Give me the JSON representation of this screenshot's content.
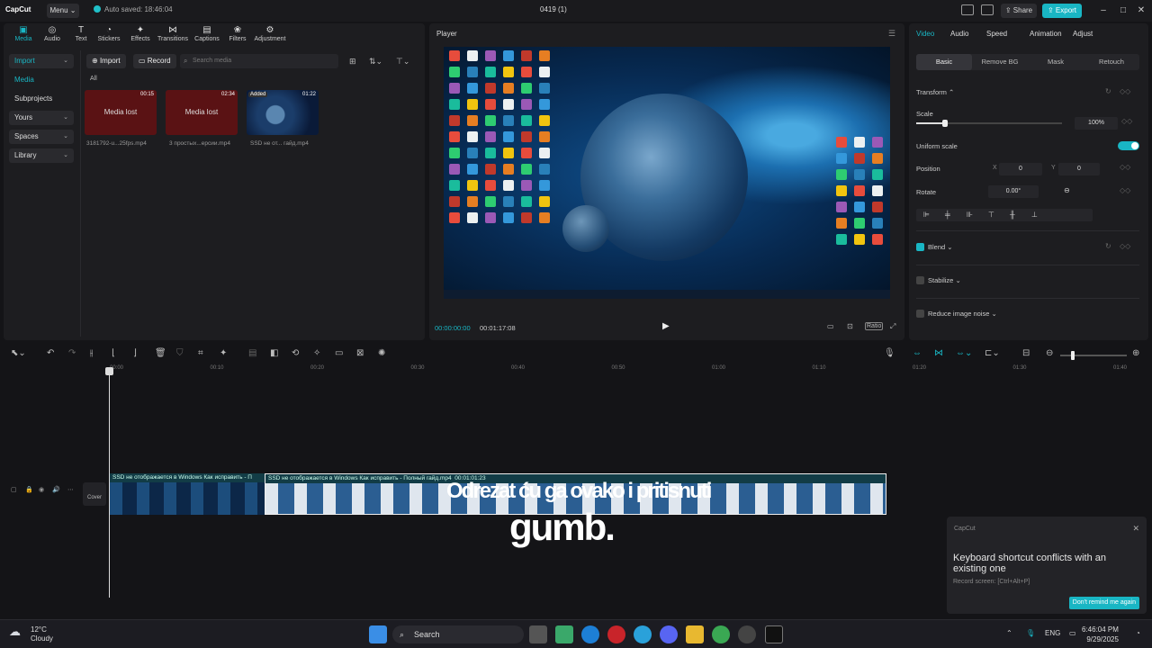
{
  "titlebar": {
    "logo": "CapCut",
    "menu_label": "Menu",
    "autosave": "Auto saved: 18:46:04",
    "project_name": "0419 (1)",
    "share_label": "Share",
    "export_label": "Export"
  },
  "media_tools": [
    {
      "label": "Media",
      "icon": "media-icon",
      "active": true
    },
    {
      "label": "Audio",
      "icon": "audio-icon"
    },
    {
      "label": "Text",
      "icon": "text-icon"
    },
    {
      "label": "Stickers",
      "icon": "stickers-icon"
    },
    {
      "label": "Effects",
      "icon": "effects-icon"
    },
    {
      "label": "Transitions",
      "icon": "transitions-icon"
    },
    {
      "label": "Captions",
      "icon": "captions-icon"
    },
    {
      "label": "Filters",
      "icon": "filters-icon"
    },
    {
      "label": "Adjustment",
      "icon": "adjustment-icon"
    }
  ],
  "sidebar": {
    "items": [
      {
        "label": "Import",
        "active": true,
        "filled": true,
        "chevron": true
      },
      {
        "label": "Media",
        "active": true
      },
      {
        "label": "Subprojects"
      },
      {
        "label": "Yours",
        "filled": true,
        "chevron": true
      },
      {
        "label": "Spaces",
        "filled": true,
        "chevron": true
      },
      {
        "label": "Library",
        "filled": true,
        "chevron": true
      }
    ]
  },
  "media": {
    "import_label": "Import",
    "record_label": "Record",
    "search_placeholder": "Search media",
    "all_label": "All",
    "clips": [
      {
        "status": "Media lost",
        "duration": "00:15",
        "name": "3181792-u...25fps.mp4"
      },
      {
        "status": "Media lost",
        "duration": "02:34",
        "name": "3 простых...ерсии.mp4"
      },
      {
        "badge": "Added",
        "duration": "01:22",
        "name": "SSD не от... гайд.mp4"
      }
    ]
  },
  "player": {
    "title": "Player",
    "current_time": "00:00:00:00",
    "total_time": "00:01:17:08",
    "ratio_label": "Ratio"
  },
  "right_panel": {
    "tabs": [
      "Video",
      "Audio",
      "Speed",
      "Animation",
      "Adjust"
    ],
    "subtabs": [
      "Basic",
      "Remove BG",
      "Mask",
      "Retouch"
    ],
    "transform_label": "Transform",
    "scale_label": "Scale",
    "scale_value": "100%",
    "scale_level": 1.0,
    "uniform_scale_label": "Uniform scale",
    "position_label": "Position",
    "pos_x_label": "X",
    "pos_x": "0",
    "pos_y_label": "Y",
    "pos_y": "0",
    "rotate_label": "Rotate",
    "rotate_value": "0.00°",
    "blend_label": "Blend",
    "stabilize_label": "Stabilize",
    "reduce_noise_label": "Reduce image noise"
  },
  "ruler": [
    "00:00",
    "00:10",
    "00:20",
    "00:30",
    "00:40",
    "00:50",
    "01:00",
    "01:10",
    "01:20",
    "01:30",
    "01:40"
  ],
  "timeline": {
    "cover_label": "Cover",
    "clip1_title": "SSD не отображается в Windows Как исправить - П",
    "clip2_title": "SSD не отображается в Windows Как исправить - Полный гайд.mp4",
    "clip2_duration": "00:01:01:23"
  },
  "subtitle": {
    "line1": "Odrezat ću ga ovako i pritisnuti",
    "line2": "gumb."
  },
  "toast": {
    "app": "CapCut",
    "message": "Keyboard shortcut conflicts with an existing one",
    "hint": "Record screen: [Ctrl+Alt+P]",
    "dont_remind": "Don't remind me again"
  },
  "taskbar": {
    "temp": "12°C",
    "weather": "Cloudy",
    "search": "Search",
    "lang": "ENG",
    "time": "6:46:04 PM",
    "date": "9/29/2025"
  }
}
